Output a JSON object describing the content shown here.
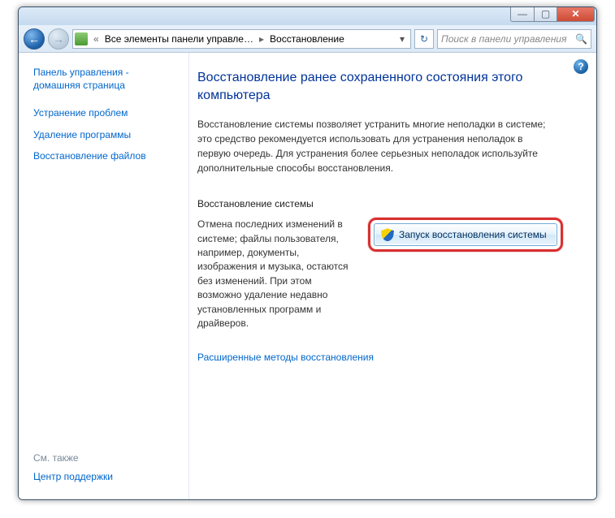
{
  "titlebar": {
    "min_glyph": "—",
    "max_glyph": "▢",
    "close_glyph": "✕"
  },
  "nav": {
    "back_glyph": "←",
    "fwd_glyph": "→",
    "chevrons": "«",
    "segment1": "Все элементы панели управле…",
    "sep": "▸",
    "segment2": "Восстановление",
    "dropdown_glyph": "▾",
    "refresh_glyph": "↻",
    "search_placeholder": "Поиск в панели управления",
    "search_icon": "🔍"
  },
  "sidebar": {
    "home": "Панель управления - домашняя страница",
    "links": [
      "Устранение проблем",
      "Удаление программы",
      "Восстановление файлов"
    ],
    "seealso_label": "См. также",
    "seealso_link": "Центр поддержки"
  },
  "content": {
    "help_glyph": "?",
    "heading": "Восстановление ранее сохраненного состояния этого компьютера",
    "description": "Восстановление системы позволяет устранить многие неполадки в системе; это средство рекомендуется использовать для устранения неполадок в первую очередь. Для устранения более серьезных неполадок используйте дополнительные способы восстановления.",
    "section_header": "Восстановление системы",
    "section_text": "Отмена последних изменений в системе; файлы пользователя, например, документы, изображения и музыка, остаются без изменений. При этом возможно удаление недавно установленных программ и драйверов.",
    "button_label": "Запуск восстановления системы",
    "advanced_link": "Расширенные методы восстановления"
  }
}
